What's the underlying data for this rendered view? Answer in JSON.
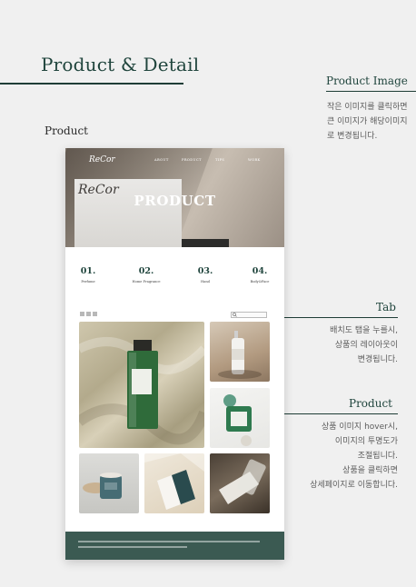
{
  "heading": "Product & Detail",
  "section_label": "Product",
  "annotations": {
    "product_image": {
      "title": "Product Image",
      "lines": [
        "작은 이미지를 클릭하면",
        "큰 이미지가 해당이미지",
        "로 변경됩니다."
      ]
    },
    "tab": {
      "title": "Tab",
      "lines": [
        "배치도 탭을 누를시,",
        "상품의 레이아웃이",
        "변경됩니다."
      ]
    },
    "product": {
      "title": "Product",
      "lines": [
        "상품 이미지 hover시,",
        "이미지의 투명도가",
        "조절됩니다.",
        "상품을 클릭하면",
        "상세페이지로 이동합니다."
      ]
    }
  },
  "mockup": {
    "logo": "ReCor",
    "nav": [
      "ABOUT",
      "PRODUCT",
      "TIPS",
      "WORK"
    ],
    "hero_title": "PRODUCT",
    "hero_box_script": "ReCor",
    "categories": [
      {
        "num": "01.",
        "name": "Perfume"
      },
      {
        "num": "02.",
        "name": "Home Fragrance"
      },
      {
        "num": "03.",
        "name": "Hand"
      },
      {
        "num": "04.",
        "name": "Body&Face"
      }
    ],
    "icons": [
      "grid-layout-icon",
      "list-layout-icon",
      "search-icon"
    ],
    "colors": {
      "brand_green": "#3b5a52",
      "accent_dark": "#20453d"
    }
  }
}
